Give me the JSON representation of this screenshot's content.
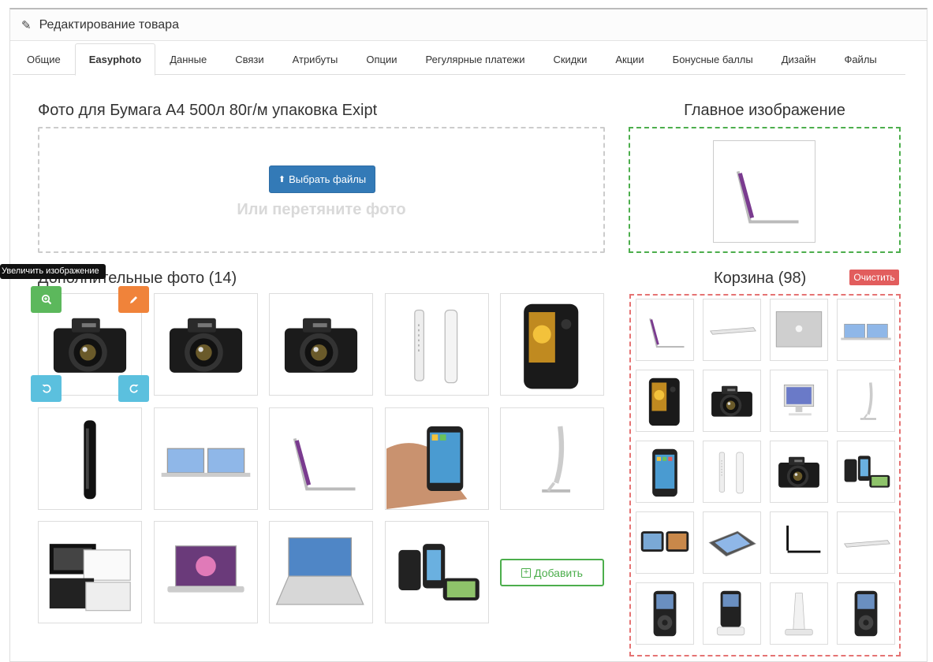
{
  "panel": {
    "title": "Редактирование товара"
  },
  "tabs": [
    "Общие",
    "Easyphoto",
    "Данные",
    "Связи",
    "Атрибуты",
    "Опции",
    "Регулярные платежи",
    "Скидки",
    "Акции",
    "Бонусные баллы",
    "Дизайн",
    "Файлы"
  ],
  "active_tab": "Easyphoto",
  "upload": {
    "title": "Фото для Бумага А4 500л 80г/м упаковка Exipt",
    "button": "Выбрать файлы",
    "hint": "Или перетяните фото"
  },
  "main_image": {
    "title": "Главное изображение",
    "icon": "laptop-side"
  },
  "tooltip": "Увеличить изображение",
  "extra": {
    "title": "Дополнительные фото (14)",
    "photos": [
      "camera",
      "camera",
      "camera",
      "phone-side",
      "smartphone",
      "phone-edge",
      "laptops-pair",
      "laptop-side",
      "iphone-hand",
      "imac-side",
      "laptop-black-white",
      "macbook-front",
      "laptop-blue",
      "iphones-trio"
    ],
    "add_label": "Добавить",
    "controls": {
      "zoom": "zoom-in-icon",
      "edit": "pencil-icon",
      "rotate_left": "rotate-left-icon",
      "rotate_right": "rotate-right-icon"
    }
  },
  "trash": {
    "title": "Корзина (98)",
    "clear_label": "Очистить",
    "photos": [
      "laptop-side",
      "laptop-flat",
      "laptop-lid",
      "laptops-pair",
      "smartphone",
      "camera",
      "imac-front",
      "imac-side",
      "iphone",
      "phone-side",
      "camera",
      "iphones-trio",
      "iphones-pair",
      "phone-flat",
      "laptop-black",
      "laptop-flat",
      "ipod",
      "ipod-dock",
      "dock",
      "ipod"
    ]
  }
}
